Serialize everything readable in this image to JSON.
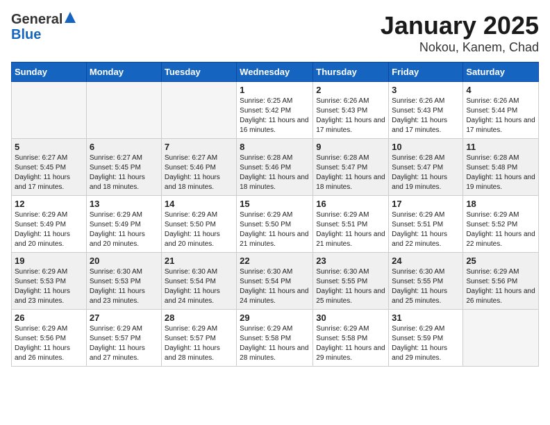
{
  "header": {
    "logo_general": "General",
    "logo_blue": "Blue",
    "title": "January 2025",
    "subtitle": "Nokou, Kanem, Chad"
  },
  "weekdays": [
    "Sunday",
    "Monday",
    "Tuesday",
    "Wednesday",
    "Thursday",
    "Friday",
    "Saturday"
  ],
  "weeks": [
    [
      {
        "day": "",
        "info": ""
      },
      {
        "day": "",
        "info": ""
      },
      {
        "day": "",
        "info": ""
      },
      {
        "day": "1",
        "info": "Sunrise: 6:25 AM\nSunset: 5:42 PM\nDaylight: 11 hours and 16 minutes."
      },
      {
        "day": "2",
        "info": "Sunrise: 6:26 AM\nSunset: 5:43 PM\nDaylight: 11 hours and 17 minutes."
      },
      {
        "day": "3",
        "info": "Sunrise: 6:26 AM\nSunset: 5:43 PM\nDaylight: 11 hours and 17 minutes."
      },
      {
        "day": "4",
        "info": "Sunrise: 6:26 AM\nSunset: 5:44 PM\nDaylight: 11 hours and 17 minutes."
      }
    ],
    [
      {
        "day": "5",
        "info": "Sunrise: 6:27 AM\nSunset: 5:45 PM\nDaylight: 11 hours and 17 minutes."
      },
      {
        "day": "6",
        "info": "Sunrise: 6:27 AM\nSunset: 5:45 PM\nDaylight: 11 hours and 18 minutes."
      },
      {
        "day": "7",
        "info": "Sunrise: 6:27 AM\nSunset: 5:46 PM\nDaylight: 11 hours and 18 minutes."
      },
      {
        "day": "8",
        "info": "Sunrise: 6:28 AM\nSunset: 5:46 PM\nDaylight: 11 hours and 18 minutes."
      },
      {
        "day": "9",
        "info": "Sunrise: 6:28 AM\nSunset: 5:47 PM\nDaylight: 11 hours and 18 minutes."
      },
      {
        "day": "10",
        "info": "Sunrise: 6:28 AM\nSunset: 5:47 PM\nDaylight: 11 hours and 19 minutes."
      },
      {
        "day": "11",
        "info": "Sunrise: 6:28 AM\nSunset: 5:48 PM\nDaylight: 11 hours and 19 minutes."
      }
    ],
    [
      {
        "day": "12",
        "info": "Sunrise: 6:29 AM\nSunset: 5:49 PM\nDaylight: 11 hours and 20 minutes."
      },
      {
        "day": "13",
        "info": "Sunrise: 6:29 AM\nSunset: 5:49 PM\nDaylight: 11 hours and 20 minutes."
      },
      {
        "day": "14",
        "info": "Sunrise: 6:29 AM\nSunset: 5:50 PM\nDaylight: 11 hours and 20 minutes."
      },
      {
        "day": "15",
        "info": "Sunrise: 6:29 AM\nSunset: 5:50 PM\nDaylight: 11 hours and 21 minutes."
      },
      {
        "day": "16",
        "info": "Sunrise: 6:29 AM\nSunset: 5:51 PM\nDaylight: 11 hours and 21 minutes."
      },
      {
        "day": "17",
        "info": "Sunrise: 6:29 AM\nSunset: 5:51 PM\nDaylight: 11 hours and 22 minutes."
      },
      {
        "day": "18",
        "info": "Sunrise: 6:29 AM\nSunset: 5:52 PM\nDaylight: 11 hours and 22 minutes."
      }
    ],
    [
      {
        "day": "19",
        "info": "Sunrise: 6:29 AM\nSunset: 5:53 PM\nDaylight: 11 hours and 23 minutes."
      },
      {
        "day": "20",
        "info": "Sunrise: 6:30 AM\nSunset: 5:53 PM\nDaylight: 11 hours and 23 minutes."
      },
      {
        "day": "21",
        "info": "Sunrise: 6:30 AM\nSunset: 5:54 PM\nDaylight: 11 hours and 24 minutes."
      },
      {
        "day": "22",
        "info": "Sunrise: 6:30 AM\nSunset: 5:54 PM\nDaylight: 11 hours and 24 minutes."
      },
      {
        "day": "23",
        "info": "Sunrise: 6:30 AM\nSunset: 5:55 PM\nDaylight: 11 hours and 25 minutes."
      },
      {
        "day": "24",
        "info": "Sunrise: 6:30 AM\nSunset: 5:55 PM\nDaylight: 11 hours and 25 minutes."
      },
      {
        "day": "25",
        "info": "Sunrise: 6:29 AM\nSunset: 5:56 PM\nDaylight: 11 hours and 26 minutes."
      }
    ],
    [
      {
        "day": "26",
        "info": "Sunrise: 6:29 AM\nSunset: 5:56 PM\nDaylight: 11 hours and 26 minutes."
      },
      {
        "day": "27",
        "info": "Sunrise: 6:29 AM\nSunset: 5:57 PM\nDaylight: 11 hours and 27 minutes."
      },
      {
        "day": "28",
        "info": "Sunrise: 6:29 AM\nSunset: 5:57 PM\nDaylight: 11 hours and 28 minutes."
      },
      {
        "day": "29",
        "info": "Sunrise: 6:29 AM\nSunset: 5:58 PM\nDaylight: 11 hours and 28 minutes."
      },
      {
        "day": "30",
        "info": "Sunrise: 6:29 AM\nSunset: 5:58 PM\nDaylight: 11 hours and 29 minutes."
      },
      {
        "day": "31",
        "info": "Sunrise: 6:29 AM\nSunset: 5:59 PM\nDaylight: 11 hours and 29 minutes."
      },
      {
        "day": "",
        "info": ""
      }
    ]
  ]
}
